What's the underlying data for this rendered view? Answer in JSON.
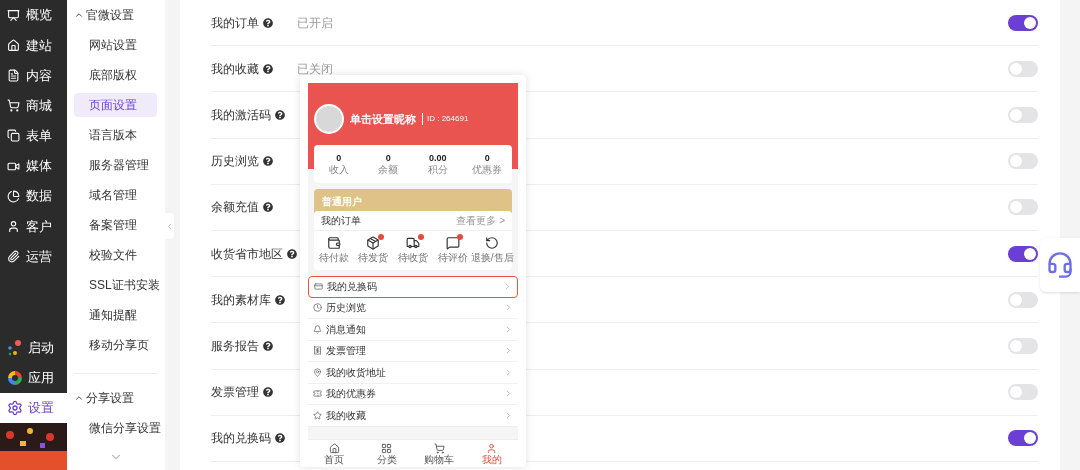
{
  "sidebar": {
    "items": [
      {
        "label": "概览",
        "selected": false
      },
      {
        "label": "建站",
        "selected": false
      },
      {
        "label": "内容",
        "selected": false
      },
      {
        "label": "商城",
        "selected": false
      },
      {
        "label": "表单",
        "selected": false
      },
      {
        "label": "媒体",
        "selected": false
      },
      {
        "label": "数据",
        "selected": false
      },
      {
        "label": "客户",
        "selected": false
      },
      {
        "label": "运营",
        "selected": false
      }
    ],
    "bottom_items": [
      {
        "label": "启动",
        "selected": false
      },
      {
        "label": "应用",
        "selected": false
      },
      {
        "label": "设置",
        "selected": true
      }
    ]
  },
  "submenu": {
    "groups": [
      {
        "title": "官微设置",
        "expanded": true,
        "items": [
          {
            "label": "网站设置",
            "selected": false
          },
          {
            "label": "底部版权",
            "selected": false
          },
          {
            "label": "页面设置",
            "selected": true
          },
          {
            "label": "语言版本",
            "selected": false
          },
          {
            "label": "服务器管理",
            "selected": false
          },
          {
            "label": "域名管理",
            "selected": false
          },
          {
            "label": "备案管理",
            "selected": false
          },
          {
            "label": "校验文件",
            "selected": false
          },
          {
            "label": "SSL证书安装",
            "selected": false
          },
          {
            "label": "通知提醒",
            "selected": false
          },
          {
            "label": "移动分享页",
            "selected": false
          }
        ]
      },
      {
        "title": "分享设置",
        "expanded": true,
        "items": [
          {
            "label": "微信分享设置",
            "selected": false
          }
        ]
      }
    ]
  },
  "settings": {
    "rows": [
      {
        "label": "我的订单",
        "status": "已开启",
        "on": true
      },
      {
        "label": "我的收藏",
        "status": "已关闭",
        "on": false
      },
      {
        "label": "我的激活码",
        "on": false
      },
      {
        "label": "历史浏览",
        "on": false
      },
      {
        "label": "余额充值",
        "on": false
      },
      {
        "label": "收货省市地区",
        "on": true
      },
      {
        "label": "我的素材库",
        "on": false
      },
      {
        "label": "服务报告",
        "on": false
      },
      {
        "label": "发票管理",
        "on": false
      },
      {
        "label": "我的兑换码",
        "on": true
      }
    ]
  },
  "preview": {
    "nickname": "单击设置昵称",
    "id": "ID : 264691",
    "stats": [
      {
        "value": "0",
        "label": "收入"
      },
      {
        "value": "0",
        "label": "余额"
      },
      {
        "value": "0.00",
        "label": "积分"
      },
      {
        "value": "0",
        "label": "优惠券"
      }
    ],
    "member_level": "普通用户",
    "orders": {
      "title": "我的订单",
      "more": "查看更多 >",
      "items": [
        {
          "label": "待付款",
          "badge": false
        },
        {
          "label": "待发货",
          "badge": true
        },
        {
          "label": "待收货",
          "badge": true
        },
        {
          "label": "待评价",
          "badge": true
        },
        {
          "label": "退换/售后",
          "badge": false
        }
      ]
    },
    "menu": [
      {
        "label": "我的兑换码",
        "selected": true
      },
      {
        "label": "历史浏览",
        "selected": false
      },
      {
        "label": "消息通知",
        "selected": false
      },
      {
        "label": "发票管理",
        "selected": false
      },
      {
        "label": "我的收货地址",
        "selected": false
      },
      {
        "label": "我的优惠券",
        "selected": false
      },
      {
        "label": "我的收藏",
        "selected": false
      }
    ],
    "tabbar": [
      {
        "label": "首页",
        "selected": false
      },
      {
        "label": "分类",
        "selected": false
      },
      {
        "label": "购物车",
        "selected": false
      },
      {
        "label": "我的",
        "selected": true
      }
    ]
  }
}
